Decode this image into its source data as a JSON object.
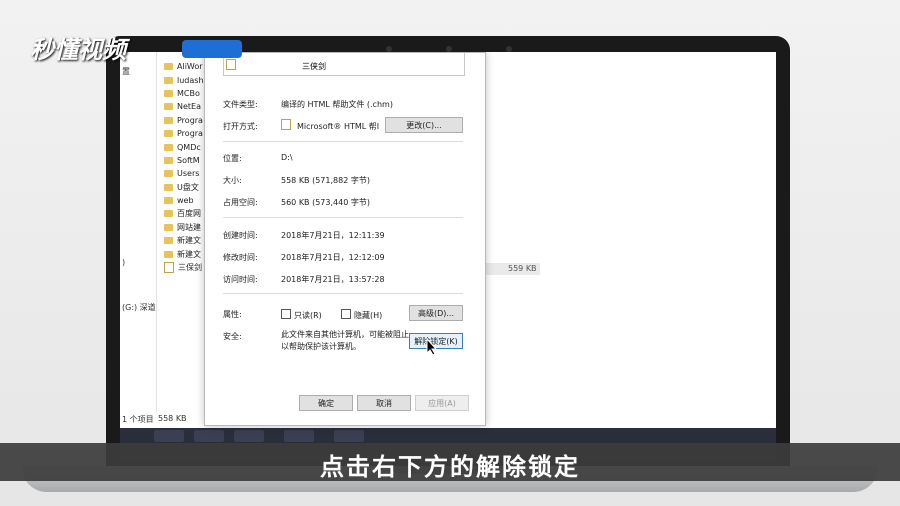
{
  "logo": {
    "text": "秒懂视频"
  },
  "subtitle": "点击右下方的解除锁定",
  "nav": {
    "left_items": [
      "置",
      ")",
      "(G:) 深道"
    ]
  },
  "files": [
    "AliWor",
    "ludash",
    "MCBo",
    "NetEa",
    "Progra",
    "Progra",
    "QMDc",
    "SoftM",
    "Users",
    "U盘文",
    "web",
    "百度网",
    "网站建",
    "新建文",
    "新建文",
    "三保剑"
  ],
  "selected_file_size": "559 KB",
  "status": {
    "count": "1 个项目",
    "size": "558 KB"
  },
  "dialog": {
    "filename": "三侠剑",
    "file_type_label": "文件类型:",
    "file_type_value": "编译的 HTML 帮助文件 (.chm)",
    "open_with_label": "打开方式:",
    "open_with_value": "Microsoft® HTML 帮I",
    "change_button": "更改(C)...",
    "location_label": "位置:",
    "location_value": "D:\\",
    "size_label": "大小:",
    "size_value": "558 KB (571,882 字节)",
    "disk_size_label": "占用空间:",
    "disk_size_value": "560 KB (573,440 字节)",
    "created_label": "创建时间:",
    "created_value": "2018年7月21日，12:11:39",
    "modified_label": "修改时间:",
    "modified_value": "2018年7月21日，12:12:09",
    "accessed_label": "访问时间:",
    "accessed_value": "2018年7月21日，13:57:28",
    "attributes_label": "属性:",
    "readonly_label": "只读(R)",
    "hidden_label": "隐藏(H)",
    "advanced_button": "高级(D)...",
    "security_label": "安全:",
    "security_text_line1": "此文件来自其他计算机，可能被阻止",
    "security_text_line2": "以帮助保护该计算机。",
    "unblock_button": "解除锁定(K)",
    "ok_button": "确定",
    "cancel_button": "取消",
    "apply_button": "应用(A)"
  },
  "colors": {
    "folder": "#e8c25a",
    "taskbar": "#2a2d3a",
    "focus": "#3c7fb1"
  }
}
